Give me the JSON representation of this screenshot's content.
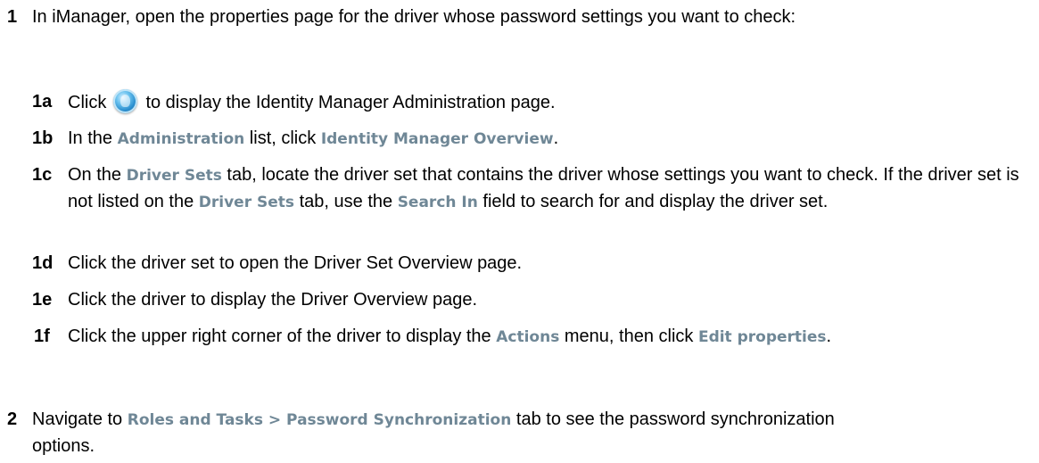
{
  "steps": [
    {
      "num": "1",
      "text": "In iManager, open the properties page for the driver whose password settings you want to check:"
    },
    {
      "num": "2",
      "parts": [
        "Navigate to ",
        "Roles and Tasks > Password Synchronization",
        " tab to see the password synchronization options."
      ]
    }
  ],
  "substeps": [
    {
      "num": "1a",
      "pre": "Click ",
      "icon": "identity-manager-icon",
      "post": " to display the Identity Manager Administration page."
    },
    {
      "num": "1b",
      "parts": [
        "In the ",
        "Administration",
        " list, click ",
        "Identity Manager Overview",
        "."
      ]
    },
    {
      "num": "1c",
      "parts": [
        "On the ",
        "Driver Sets",
        " tab, locate the driver set that contains the driver whose settings you want to check. If the driver set is not listed on the ",
        "Driver Sets",
        " tab, use the ",
        "Search In",
        " field to search for and display the driver set."
      ]
    },
    {
      "num": "1d",
      "text": "Click the driver set to open the Driver Set Overview page."
    },
    {
      "num": "1e",
      "text": "Click the driver to display the Driver Overview page."
    },
    {
      "num": "1f",
      "parts": [
        "Click the upper right corner of the driver to display the ",
        "Actions",
        " menu, then click ",
        "Edit properties",
        "."
      ]
    }
  ]
}
